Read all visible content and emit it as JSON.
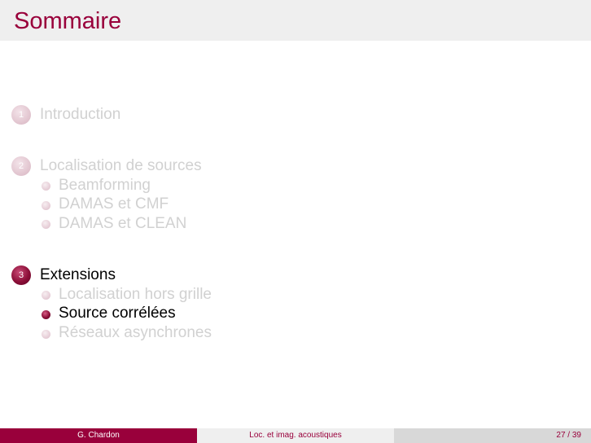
{
  "header": {
    "title": "Sommaire"
  },
  "toc": {
    "sections": [
      {
        "number": "1",
        "label": "Introduction",
        "subsections": []
      },
      {
        "number": "2",
        "label": "Localisation de sources",
        "subsections": [
          "Beamforming",
          "DAMAS et CMF",
          "DAMAS et CLEAN"
        ]
      },
      {
        "number": "3",
        "label": "Extensions",
        "subsections": [
          "Localisation hors grille",
          "Source corrélées",
          "Réseaux asynchrones"
        ]
      }
    ]
  },
  "footer": {
    "author": "G. Chardon",
    "short_title": "Loc. et imag. acoustiques",
    "page": "27 / 39"
  },
  "colors": {
    "accent": "#99003b",
    "faded_text": "#d1d1d1",
    "active_text": "#000000"
  }
}
